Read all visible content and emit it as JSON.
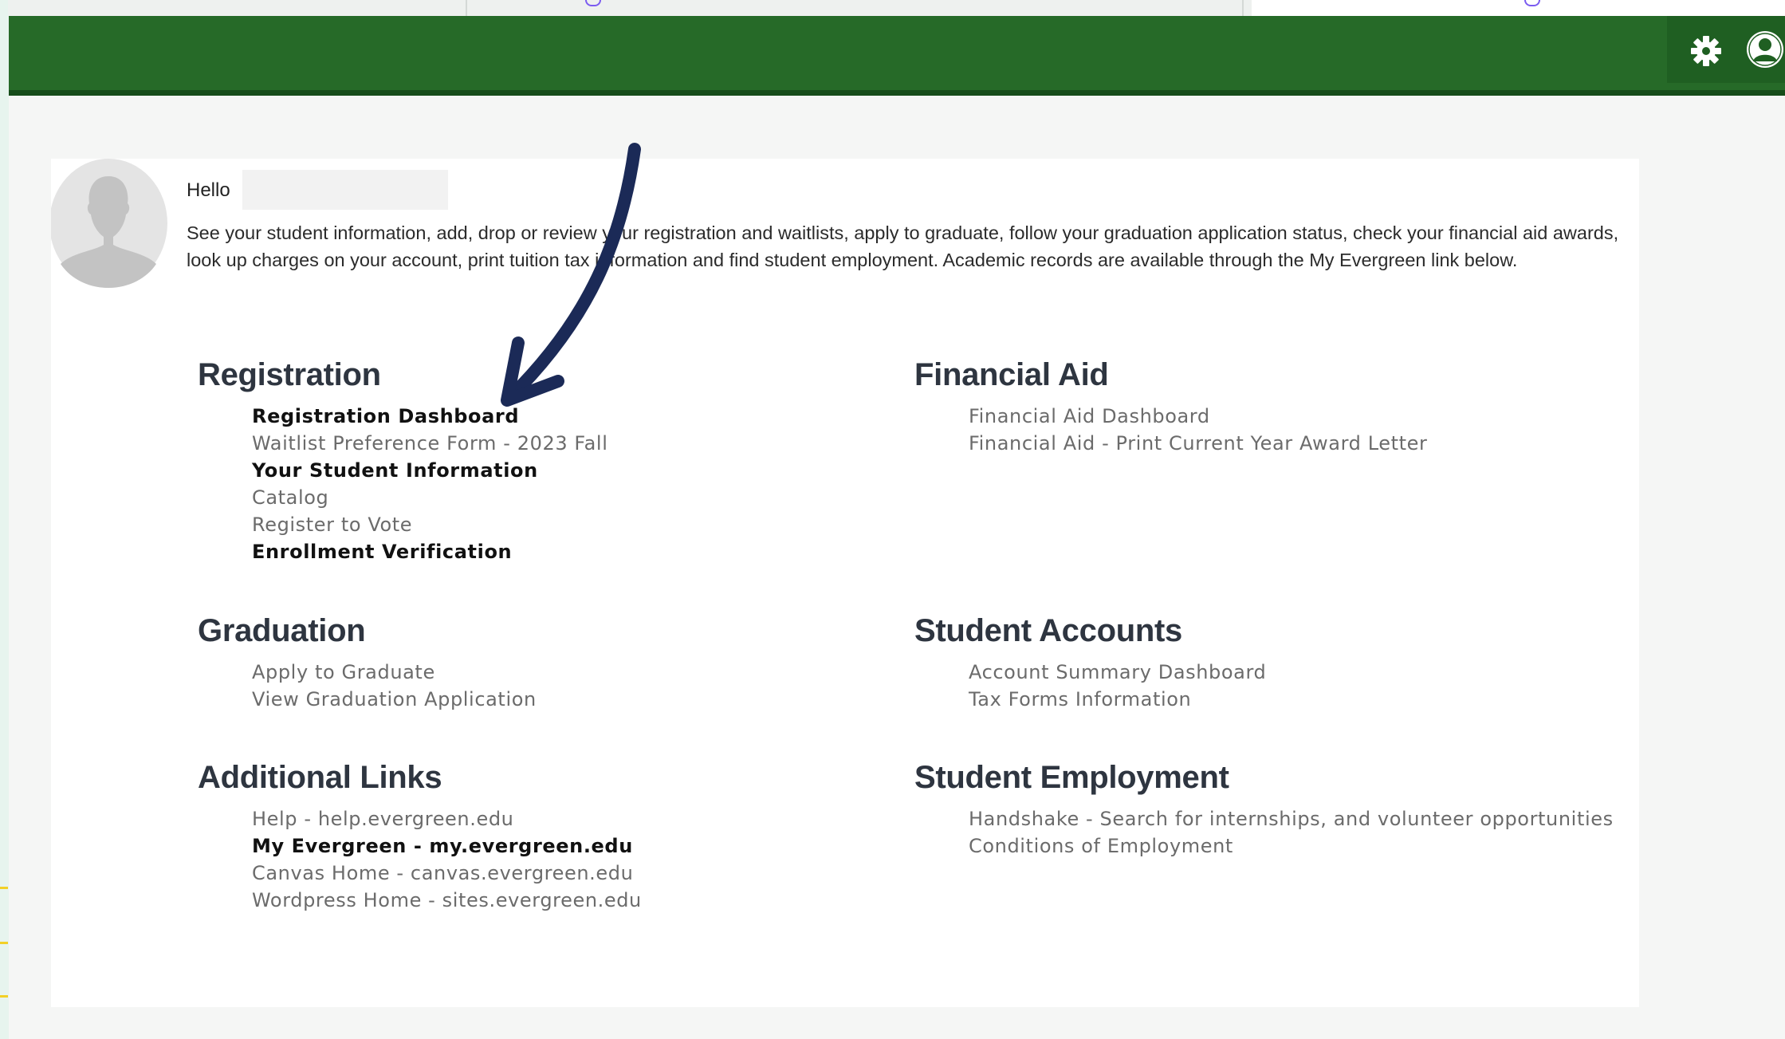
{
  "header": {
    "settings_icon": "gear-icon",
    "account_icon": "user-icon",
    "brand_color": "#266a28"
  },
  "profile": {
    "greeting": "Hello",
    "intro": "See your student information, add, drop or review your registration and waitlists, apply to graduate, follow your graduation application status, check your financial aid awards, look up charges on your account, print tuition tax information and find student employment. Academic records are available through the My Evergreen link below."
  },
  "sections": {
    "registration": {
      "title": "Registration",
      "links": [
        {
          "label": "Registration Dashboard",
          "active": true
        },
        {
          "label": "Waitlist Preference Form - 2023 Fall",
          "active": false
        },
        {
          "label": "Your Student Information",
          "active": true
        },
        {
          "label": "Catalog",
          "active": false
        },
        {
          "label": "Register to Vote",
          "active": false
        },
        {
          "label": "Enrollment Verification",
          "active": true
        }
      ]
    },
    "financial_aid": {
      "title": "Financial Aid",
      "links": [
        {
          "label": "Financial Aid Dashboard",
          "active": false
        },
        {
          "label": "Financial Aid - Print Current Year Award Letter",
          "active": false
        }
      ]
    },
    "graduation": {
      "title": "Graduation",
      "links": [
        {
          "label": "Apply to Graduate",
          "active": false
        },
        {
          "label": "View Graduation Application",
          "active": false
        }
      ]
    },
    "student_accounts": {
      "title": "Student Accounts",
      "links": [
        {
          "label": "Account Summary Dashboard",
          "active": false
        },
        {
          "label": "Tax Forms Information",
          "active": false
        }
      ]
    },
    "additional_links": {
      "title": "Additional Links",
      "links": [
        {
          "label": "Help - help.evergreen.edu",
          "active": false
        },
        {
          "label": "My Evergreen - my.evergreen.edu",
          "active": true
        },
        {
          "label": "Canvas Home - canvas.evergreen.edu",
          "active": false
        },
        {
          "label": "Wordpress Home - sites.evergreen.edu",
          "active": false
        }
      ]
    },
    "student_employment": {
      "title": "Student Employment",
      "links": [
        {
          "label": "Handshake - Search for internships, and volunteer opportunities",
          "active": false
        },
        {
          "label": "Conditions of Employment",
          "active": false
        }
      ]
    }
  },
  "annotation": {
    "arrow_color": "#1b2a57",
    "accent_yellow": "#f2d027"
  }
}
